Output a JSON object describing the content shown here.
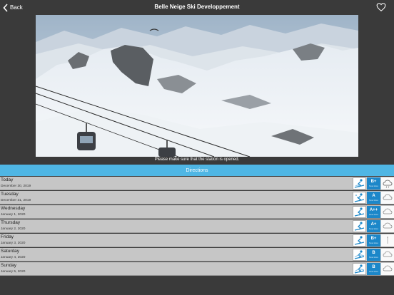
{
  "nav": {
    "back_label": "Back",
    "title": "Belle Neige Ski Developpement"
  },
  "notice": "Please make sure that the station is opened.",
  "directions_label": "Directions",
  "days": [
    {
      "day": "Today",
      "date": "December 30, 2019",
      "grade": "B+",
      "grade_sub": "Snow index"
    },
    {
      "day": "Tuesday",
      "date": "December 31, 2019",
      "grade": "A",
      "grade_sub": "Snow index"
    },
    {
      "day": "Wednesday",
      "date": "January 1, 2020",
      "grade": "A++",
      "grade_sub": "Snow index"
    },
    {
      "day": "Thursday",
      "date": "January 2, 2020",
      "grade": "A+",
      "grade_sub": "Snow index"
    },
    {
      "day": "Friday",
      "date": "January 3, 2020",
      "grade": "B+",
      "grade_sub": "Snow index"
    },
    {
      "day": "Saturday",
      "date": "January 4, 2020",
      "grade": "B",
      "grade_sub": "Snow index"
    },
    {
      "day": "Sunday",
      "date": "January 5, 2020",
      "grade": "B",
      "grade_sub": "Snow index"
    }
  ],
  "colors": {
    "background": "#3a3a3a",
    "accent": "#4fb6e4",
    "grade": "#1c87c9",
    "row": "#c6c6c6"
  },
  "icons": {
    "back": "chevron-left-icon",
    "favorite": "heart-icon",
    "skier": "skier-icon",
    "weather": "weather-icon"
  }
}
